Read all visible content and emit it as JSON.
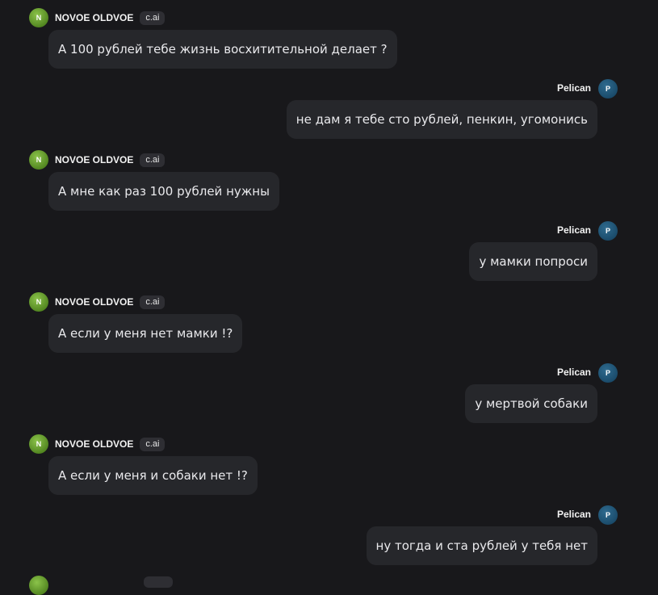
{
  "ai": {
    "name": "NOVOE OLDVOE",
    "badge": "c.ai",
    "initial": "N"
  },
  "user": {
    "name": "Pelican",
    "initial": "P"
  },
  "messages": [
    {
      "role": "ai",
      "text": "А 100 рублей тебе жизнь восхитительной делает ?"
    },
    {
      "role": "user",
      "text": "не дам я тебе сто рублей, пенкин, угомонись"
    },
    {
      "role": "ai",
      "text": "А мне как раз 100 рублей нужны"
    },
    {
      "role": "user",
      "text": "у мамки попроси"
    },
    {
      "role": "ai",
      "text": "А если у меня нет мамки !?"
    },
    {
      "role": "user",
      "text": "у мертвой собаки"
    },
    {
      "role": "ai",
      "text": "А если у меня и собаки нет !?"
    },
    {
      "role": "user",
      "text": "ну тогда и ста рублей у тебя нет"
    }
  ]
}
